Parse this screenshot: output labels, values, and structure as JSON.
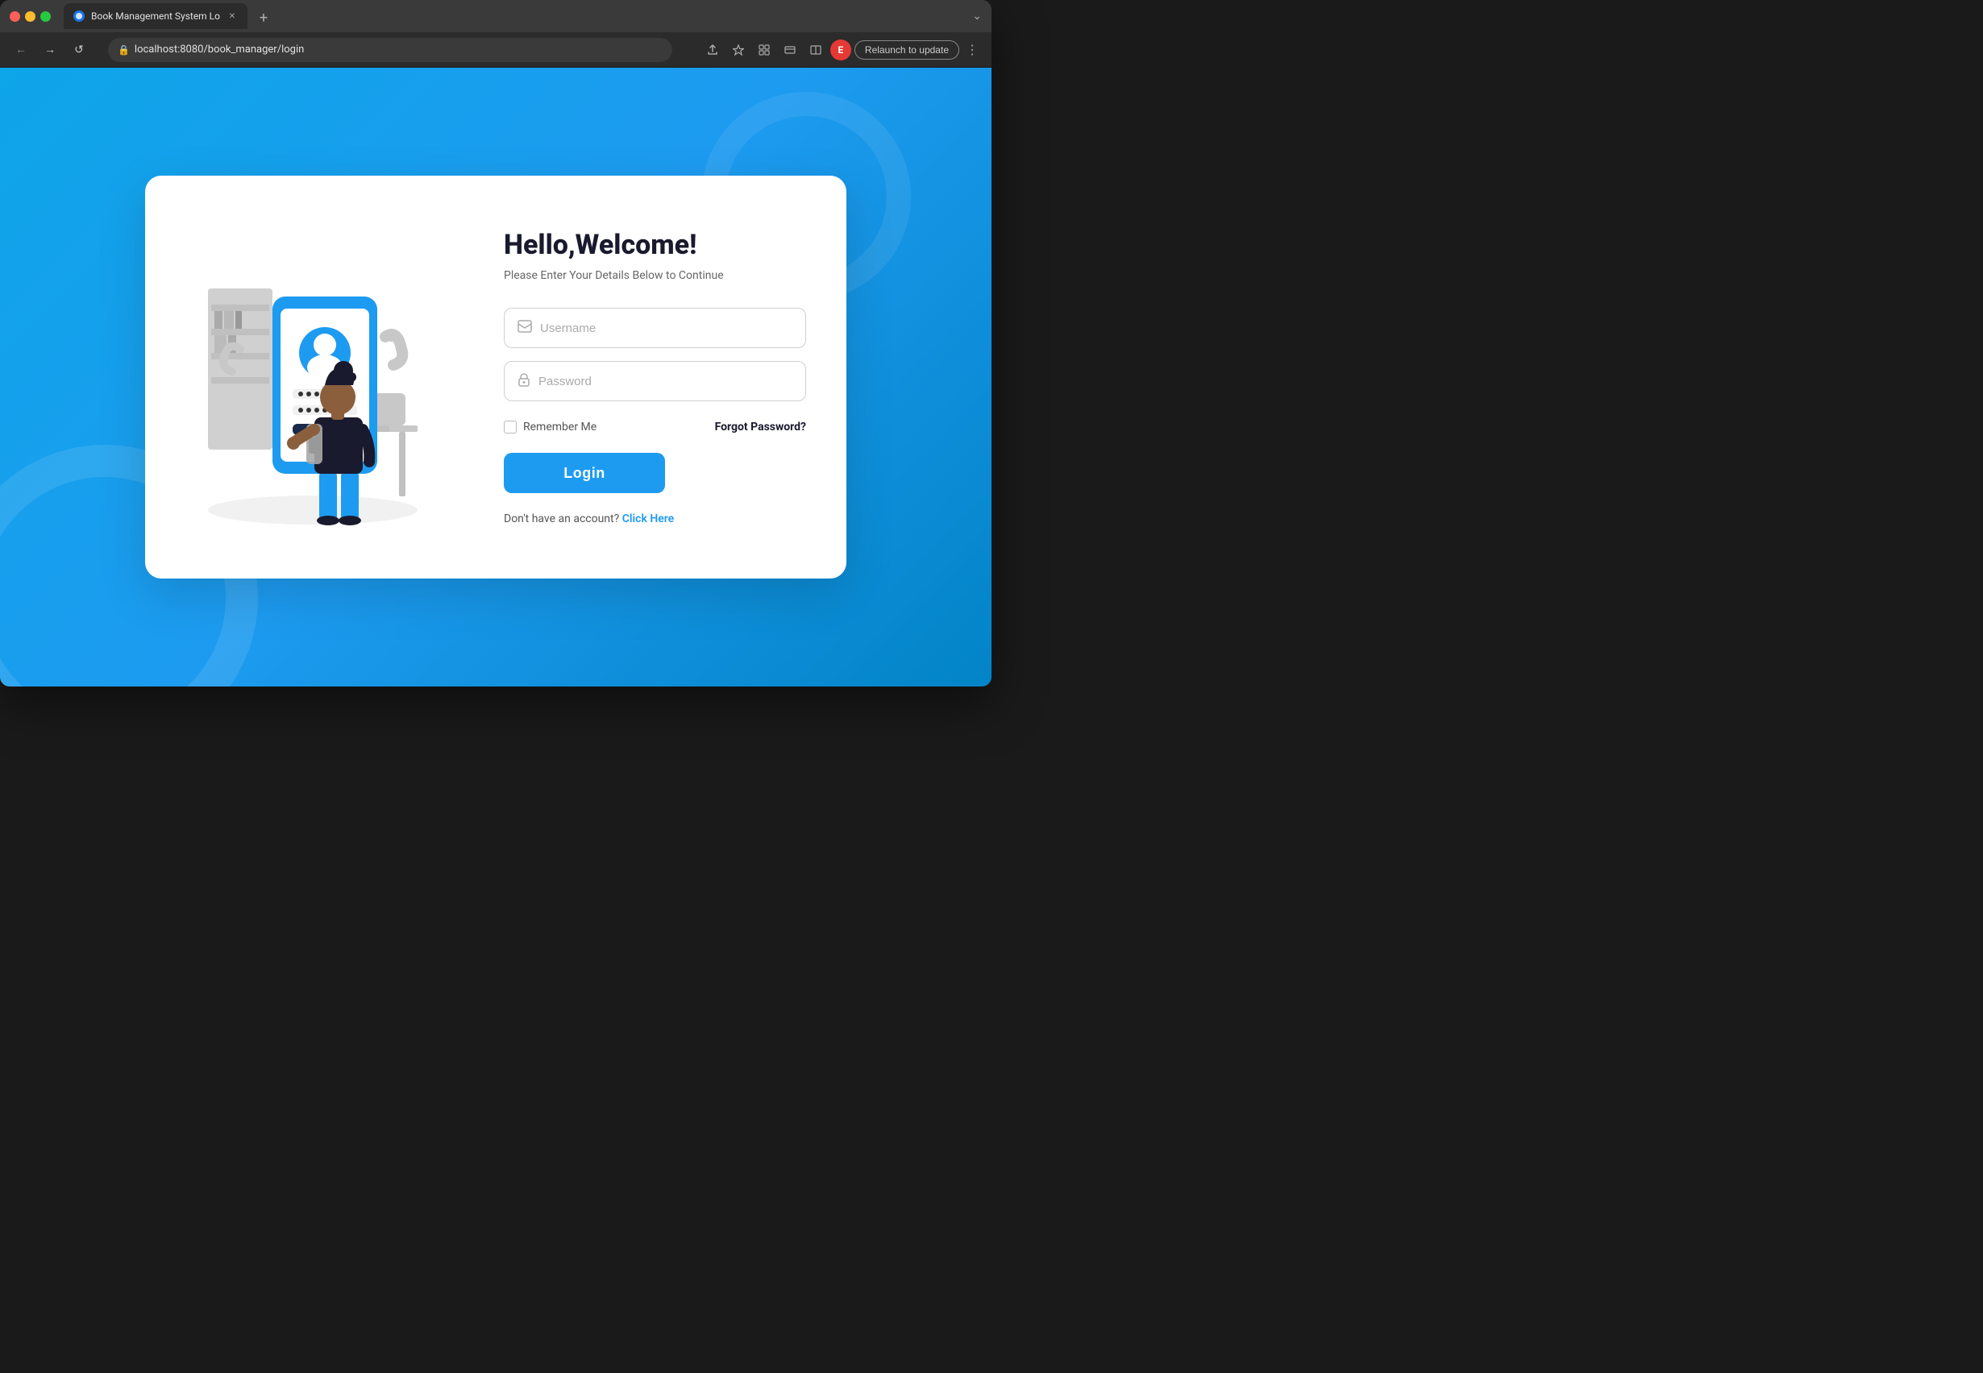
{
  "browser": {
    "tab_title": "Book Management System Lo",
    "url": "localhost:8080/book_manager/login",
    "relaunch_label": "Relaunch to update",
    "profile_initial": "E",
    "new_tab_label": "+",
    "nav": {
      "back": "←",
      "forward": "→",
      "refresh": "↺"
    }
  },
  "page": {
    "background_color": "#1d9bf0"
  },
  "login": {
    "title": "Hello,Welcome!",
    "subtitle": "Please Enter Your Details Below to Continue",
    "username_placeholder": "Username",
    "password_placeholder": "Password",
    "remember_me_label": "Remember Me",
    "forgot_password_label": "Forgot Password?",
    "login_button_label": "Login",
    "no_account_text": "Don't have an account?",
    "signup_link_label": "Click Here"
  }
}
